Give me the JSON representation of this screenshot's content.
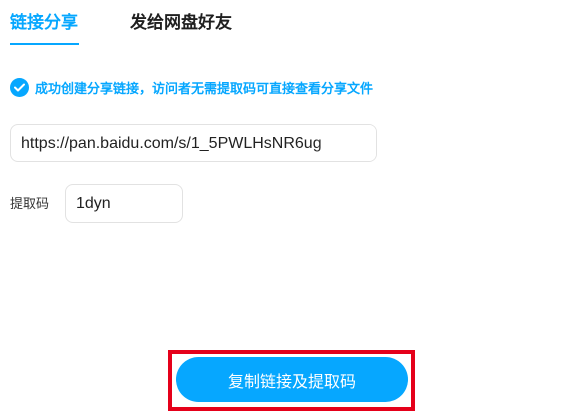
{
  "tabs": {
    "share_link": "链接分享",
    "send_to_friend": "发给网盘好友"
  },
  "notice": {
    "text": "成功创建分享链接，访问者无需提取码可直接查看分享文件",
    "icon": "check-circle-icon"
  },
  "link": {
    "value": "https://pan.baidu.com/s/1_5PWLHsNR6ug"
  },
  "code": {
    "label": "提取码",
    "value": "1dyn"
  },
  "copy_button": {
    "label": "复制链接及提取码"
  },
  "colors": {
    "accent": "#06a7ff",
    "highlight_frame": "#e5001a"
  }
}
